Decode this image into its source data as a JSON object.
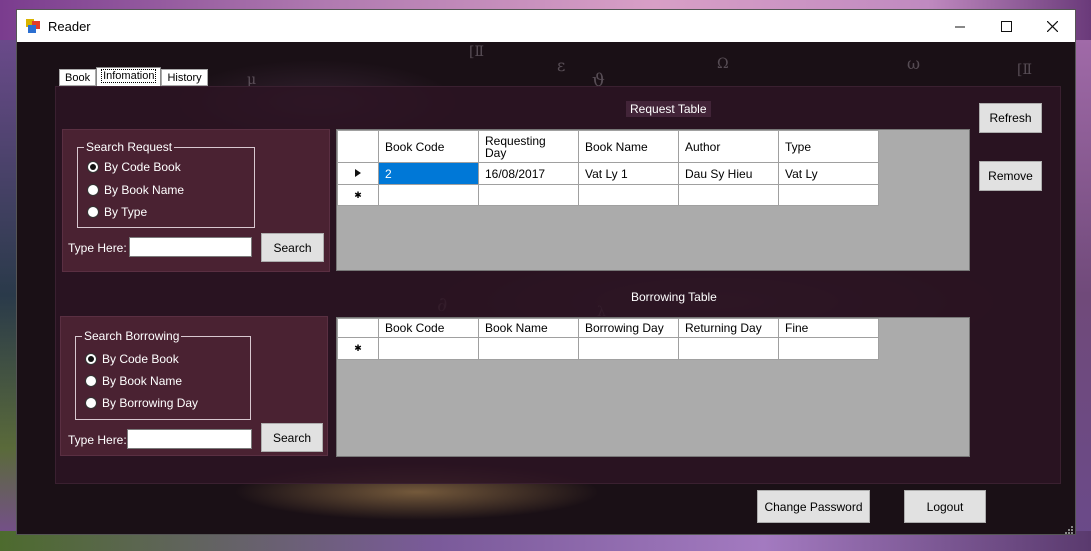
{
  "window": {
    "title": "Reader"
  },
  "tabs": [
    {
      "label": "Book"
    },
    {
      "label": "Infomation"
    },
    {
      "label": "History"
    }
  ],
  "request_section": {
    "title": "Request Table",
    "search_group": {
      "legend": "Search Request",
      "options": [
        "By Code Book",
        "By Book Name",
        "By Type"
      ],
      "selected_index": 0,
      "type_label": "Type Here:",
      "input_value": "",
      "search_label": "Search"
    },
    "table": {
      "columns": [
        "Book Code",
        "Requesting Day",
        "Book Name",
        "Author",
        "Type"
      ],
      "rows": [
        [
          "2",
          "16/08/2017",
          "Vat Ly 1",
          "Dau Sy Hieu",
          "Vat Ly"
        ]
      ]
    },
    "refresh_label": "Refresh",
    "remove_label": "Remove"
  },
  "borrowing_section": {
    "title": "Borrowing Table",
    "search_group": {
      "legend": "Search Borrowing",
      "options": [
        "By Code Book",
        "By Book Name",
        "By Borrowing Day"
      ],
      "selected_index": 0,
      "type_label": "Type Here:",
      "input_value": "",
      "search_label": "Search"
    },
    "table": {
      "columns": [
        "Book Code",
        "Book Name",
        "Borrowing Day",
        "Returning Day",
        "Fine"
      ],
      "rows": []
    }
  },
  "footer": {
    "change_password_label": "Change Password",
    "logout_label": "Logout"
  },
  "icons": {
    "app": "app-icon",
    "minimize": "minimize-icon",
    "maximize": "maximize-icon",
    "close": "close-icon",
    "current_row": "row-pointer-icon",
    "new_row": "new-row-asterisk-icon"
  }
}
